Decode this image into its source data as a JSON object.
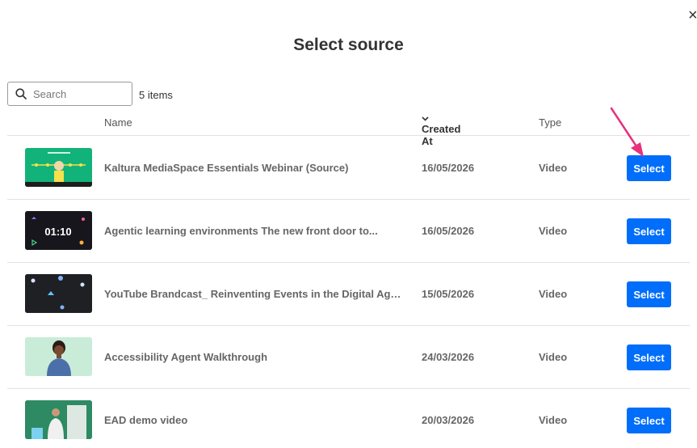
{
  "dialog": {
    "close_glyph": "×",
    "title": "Select source"
  },
  "search": {
    "placeholder": "Search",
    "value": ""
  },
  "item_count": "5 items",
  "columns": {
    "name": "Name",
    "created_at": "Created At",
    "type": "Type"
  },
  "rows": [
    {
      "name": "Kaltura MediaSpace Essentials Webinar (Source)",
      "created": "16/05/2026",
      "type": "Video",
      "action": "Select"
    },
    {
      "name": "Agentic learning environments The new front door to...",
      "created": "16/05/2026",
      "type": "Video",
      "action": "Select"
    },
    {
      "name": "YouTube Brandcast_ Reinventing Events in the Digital Age...",
      "created": "15/05/2026",
      "type": "Video",
      "action": "Select"
    },
    {
      "name": "Accessibility Agent Walkthrough",
      "created": "24/03/2026",
      "type": "Video",
      "action": "Select"
    },
    {
      "name": "EAD demo video",
      "created": "20/03/2026",
      "type": "Video",
      "action": "Select"
    }
  ],
  "thumbnail_text": {
    "timer": "01:10"
  },
  "colors": {
    "select_button": "#006efa",
    "annotation_arrow": "#e8307e"
  }
}
